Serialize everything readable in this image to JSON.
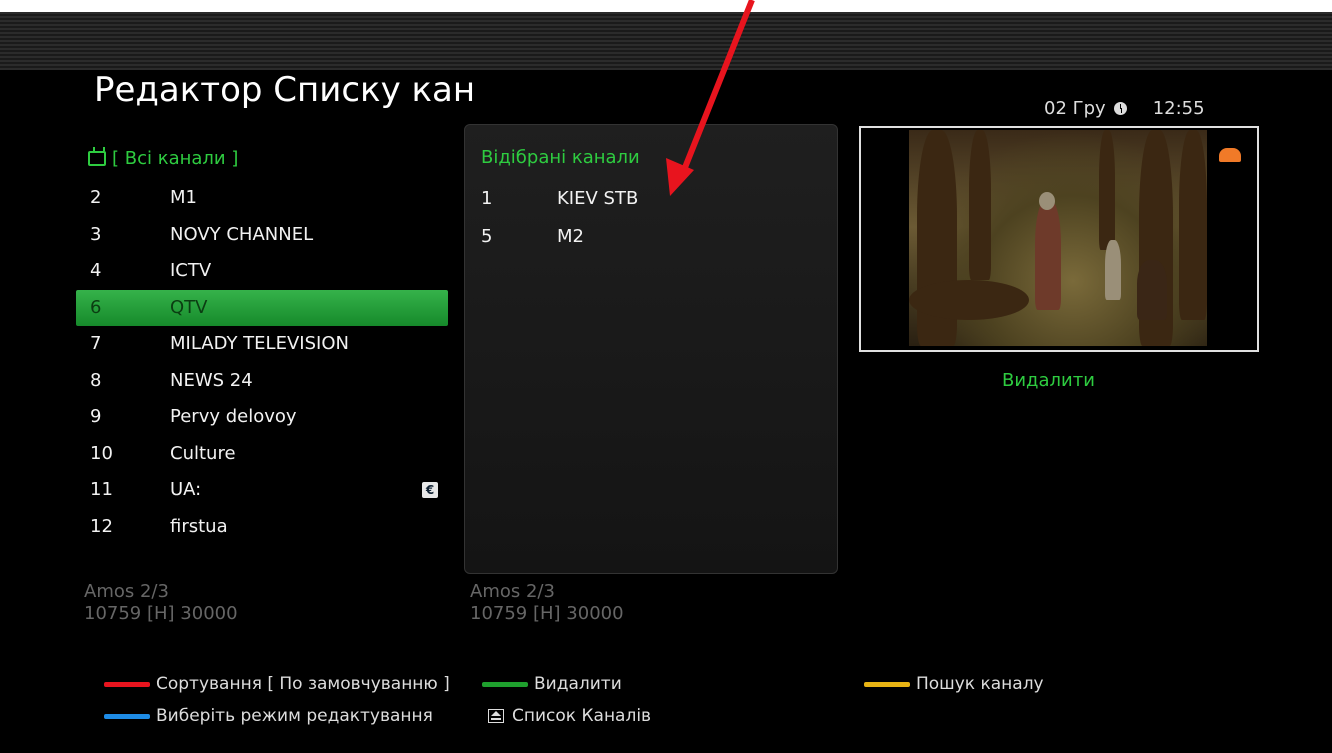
{
  "header": {
    "title": "Редактор Списку кан",
    "date": "02 Гру",
    "time": "12:55"
  },
  "left_list": {
    "heading": "[ Всі канали ]",
    "channels": [
      {
        "num": "2",
        "name": "M1"
      },
      {
        "num": "3",
        "name": "NOVY CHANNEL"
      },
      {
        "num": "4",
        "name": "ICTV"
      },
      {
        "num": "6",
        "name": "QTV"
      },
      {
        "num": "7",
        "name": "MILADY TELEVISION"
      },
      {
        "num": "8",
        "name": "NEWS 24"
      },
      {
        "num": "9",
        "name": "Pervy delovoy"
      },
      {
        "num": "10",
        "name": "Culture"
      },
      {
        "num": "11",
        "name": "UA:"
      },
      {
        "num": "12",
        "name": "firstua"
      }
    ],
    "selected_index": 3,
    "euro_badge": "€",
    "satellite": "Amos 2/3",
    "transponder": "10759 [H] 30000"
  },
  "middle_list": {
    "heading": "Відібрані канали",
    "channels": [
      {
        "num": "1",
        "name": "KIEV STB"
      },
      {
        "num": "5",
        "name": "M2"
      }
    ],
    "satellite": "Amos 2/3",
    "transponder": "10759 [H] 30000"
  },
  "preview": {
    "action_label": "Видалити"
  },
  "footer": {
    "red": "Сортування [ По замовчуванню ]",
    "green": "Видалити",
    "yellow": "Пошук каналу",
    "blue": "Виберіть режим редактування",
    "eject": "Список Каналів"
  },
  "colors": {
    "accent_green": "#2ecc40",
    "red": "#e8141e",
    "green": "#1fa02e",
    "yellow": "#e8b414",
    "blue": "#1e8ce6",
    "arrow": "#e8141e"
  }
}
